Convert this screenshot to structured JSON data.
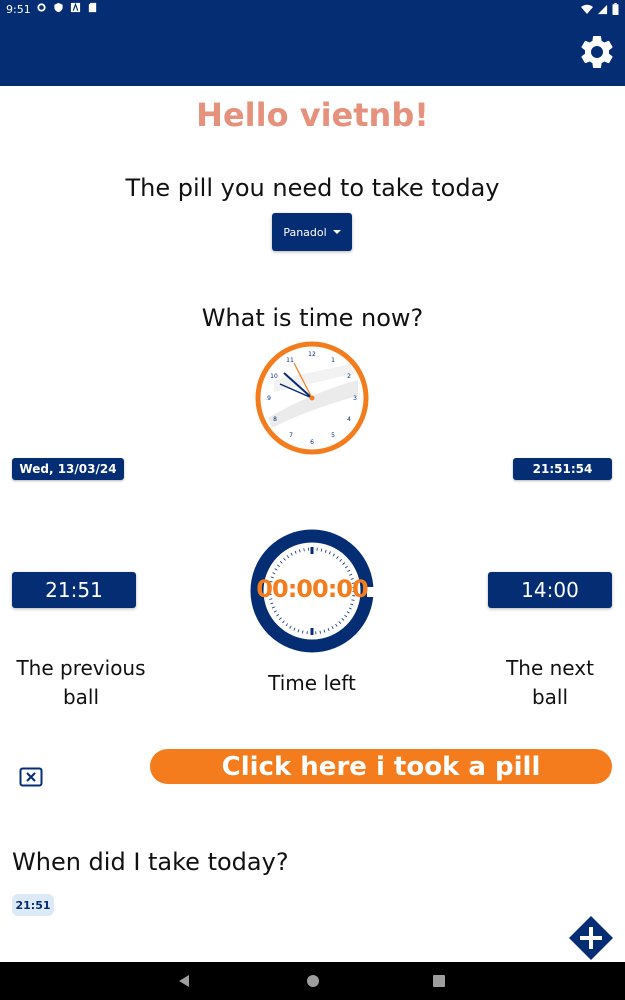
{
  "status_bar": {
    "time": "9:51"
  },
  "greeting": "Hello vietnb!",
  "pill_section": {
    "title": "The pill you need to take today",
    "selected_pill": "Panadol"
  },
  "time_section": {
    "title": "What is time now?",
    "date": "Wed, 13/03/24",
    "clock_time": "21:51:54"
  },
  "schedule": {
    "previous_time": "21:51",
    "previous_label_line1": "The previous",
    "previous_label_line2": "ball",
    "timer": "00:00:00",
    "timer_label": "Time left",
    "next_time": "14:00",
    "next_label_line1": "The next",
    "next_label_line2": "ball"
  },
  "took_pill_button": "Click here i took a pill",
  "history": {
    "title": "When did I take today?",
    "times": [
      "21:51"
    ]
  },
  "colors": {
    "primary": "#052d74",
    "accent": "#f47c1c",
    "greeting": "#e5917b",
    "chip_bg": "#dceaf7"
  },
  "icons": [
    "settings-gear-icon",
    "cancel-icon",
    "add-icon",
    "back-icon",
    "home-icon",
    "recents-icon"
  ]
}
